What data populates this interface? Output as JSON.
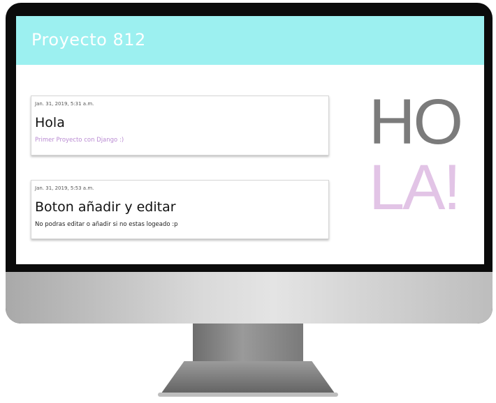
{
  "app": {
    "title": "Proyecto 812"
  },
  "posts": [
    {
      "date": "Jan. 31, 2019, 5:31 a.m.",
      "title": "Hola",
      "text": "Primer Proyecto con Django :)"
    },
    {
      "date": "Jan. 31, 2019, 5:53 a.m.",
      "title": "Boton añadir y editar",
      "text": "No podras editar o añadir si no estas logeado :p"
    }
  ],
  "hero": {
    "line1": "HO",
    "line2": "LA!"
  },
  "colors": {
    "header_bg": "#9cf0f0",
    "hero_line1": "#7b7b7b",
    "hero_line2": "#e2c4e6",
    "monitor_bezel": "#0b0b0b"
  }
}
